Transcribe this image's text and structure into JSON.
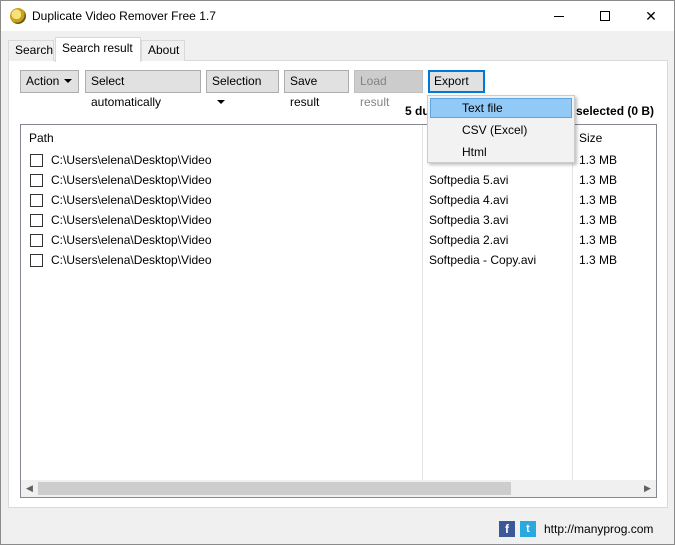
{
  "window": {
    "title": "Duplicate Video Remover Free 1.7"
  },
  "tabs": [
    {
      "label": "Search"
    },
    {
      "label": "Search result"
    },
    {
      "label": "About"
    }
  ],
  "toolbar": {
    "action": "Action",
    "select_auto": "Select automatically",
    "selection": "Selection",
    "save": "Save result",
    "load": "Load result",
    "export": "Export"
  },
  "status": {
    "left": "5 du",
    "right": "selected (0 B)"
  },
  "table": {
    "headers": {
      "path": "Path",
      "size": "Size"
    },
    "rows": [
      {
        "path": "C:\\Users\\elena\\Desktop\\Video",
        "name": "",
        "size": "1.3 MB"
      },
      {
        "path": "C:\\Users\\elena\\Desktop\\Video",
        "name": "Softpedia 5.avi",
        "size": "1.3 MB"
      },
      {
        "path": "C:\\Users\\elena\\Desktop\\Video",
        "name": "Softpedia 4.avi",
        "size": "1.3 MB"
      },
      {
        "path": "C:\\Users\\elena\\Desktop\\Video",
        "name": "Softpedia 3.avi",
        "size": "1.3 MB"
      },
      {
        "path": "C:\\Users\\elena\\Desktop\\Video",
        "name": "Softpedia 2.avi",
        "size": "1.3 MB"
      },
      {
        "path": "C:\\Users\\elena\\Desktop\\Video",
        "name": "Softpedia - Copy.avi",
        "size": "1.3 MB"
      }
    ]
  },
  "export_menu": {
    "items": [
      {
        "label": "Text file"
      },
      {
        "label": "CSV (Excel)"
      },
      {
        "label": "Html"
      }
    ]
  },
  "footer": {
    "fb": "f",
    "tw": "t",
    "link": "http://manyprog.com"
  },
  "colors": {
    "accent": "#0078d7",
    "menu_highlight": "#91c9f7",
    "facebook": "#3b5998",
    "twitter": "#2aa9e0"
  }
}
